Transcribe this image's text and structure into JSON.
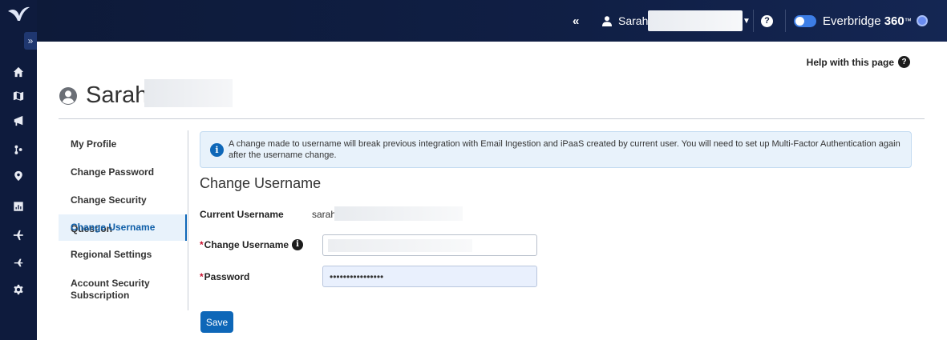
{
  "topbar": {
    "collapse_glyph": "«",
    "user_name": "Sarah",
    "brand_name": "Everbridge",
    "brand_suffix": "360",
    "brand_tm": "™"
  },
  "sidebar_expand_glyph": "»",
  "leftnav_icons": [
    "home-icon",
    "map-icon",
    "megaphone-icon",
    "incident-icon",
    "location-pin-icon",
    "dashboard-icon",
    "plane-icon",
    "airplane-arrival-icon",
    "gear-icon"
  ],
  "help_link": {
    "label": "Help with this page"
  },
  "page": {
    "title": "Sarah"
  },
  "side_menu": {
    "items": [
      {
        "label": "My Profile",
        "active": false
      },
      {
        "label": "Change Password",
        "active": false
      },
      {
        "label": "Change Security Question",
        "active": false
      },
      {
        "label": "Change Username",
        "active": true
      },
      {
        "label": "Regional Settings",
        "active": false
      },
      {
        "label": "Account Security Subscription",
        "active": false
      }
    ]
  },
  "info": {
    "message": "A change made to username will break previous integration with Email Ingestion and iPaaS created by current user. You will need to set up Multi-Factor Authentication again after the username change."
  },
  "form": {
    "title": "Change Username",
    "current_username_label": "Current Username",
    "current_username_value": "sarah.",
    "change_username_label": "Change Username",
    "change_username_value": "",
    "password_label": "Password",
    "password_value": "••••••••••••••••",
    "required_marker": "*",
    "save_label": "Save"
  },
  "colors": {
    "nav_bg": "#0e1b3d",
    "accent": "#0e67b8",
    "required": "#c8102e",
    "info_bg": "#e8f2fb"
  }
}
